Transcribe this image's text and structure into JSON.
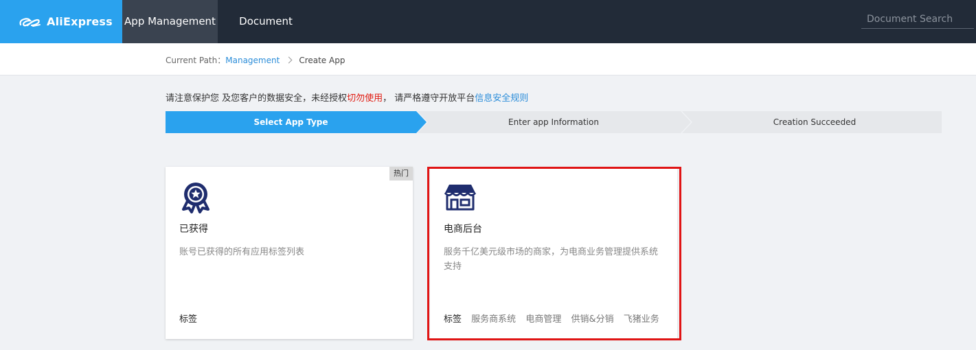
{
  "header": {
    "brand": "AliExpress",
    "nav": [
      "App Management",
      "Document"
    ],
    "search_placeholder": "Document Search"
  },
  "breadcrumb": {
    "prefix": "Current Path：",
    "link": "Management",
    "current": "Create App"
  },
  "notice": {
    "part1": "请注意保护您 及您客户的数据安全，未经授权",
    "warning": "切勿使用",
    "part2": "， 请严格遵守开放平台",
    "link": "信息安全规则"
  },
  "steps": [
    "Select App Type",
    "Enter app Information",
    "Creation Succeeded"
  ],
  "cards": [
    {
      "badge": "热门",
      "icon": "award-badge-icon",
      "title": "已获得",
      "description": "账号已获得的所有应用标签列表",
      "tags_label": "标签",
      "tags": []
    },
    {
      "icon": "storefront-icon",
      "title": "电商后台",
      "description": "服务千亿美元级市场的商家，为电商业务管理提供系统支持",
      "tags_label": "标签",
      "tags": [
        "服务商系统",
        "电商管理",
        "供销&分销",
        "飞猪业务"
      ]
    }
  ],
  "colors": {
    "topbar": "#222b38",
    "brand": "#2aa2ee",
    "active_step": "#2aa2ee",
    "link": "#2b8dd9",
    "warning": "#e0190f",
    "highlight_border": "#e01414",
    "icon": "#1f2d6e"
  }
}
